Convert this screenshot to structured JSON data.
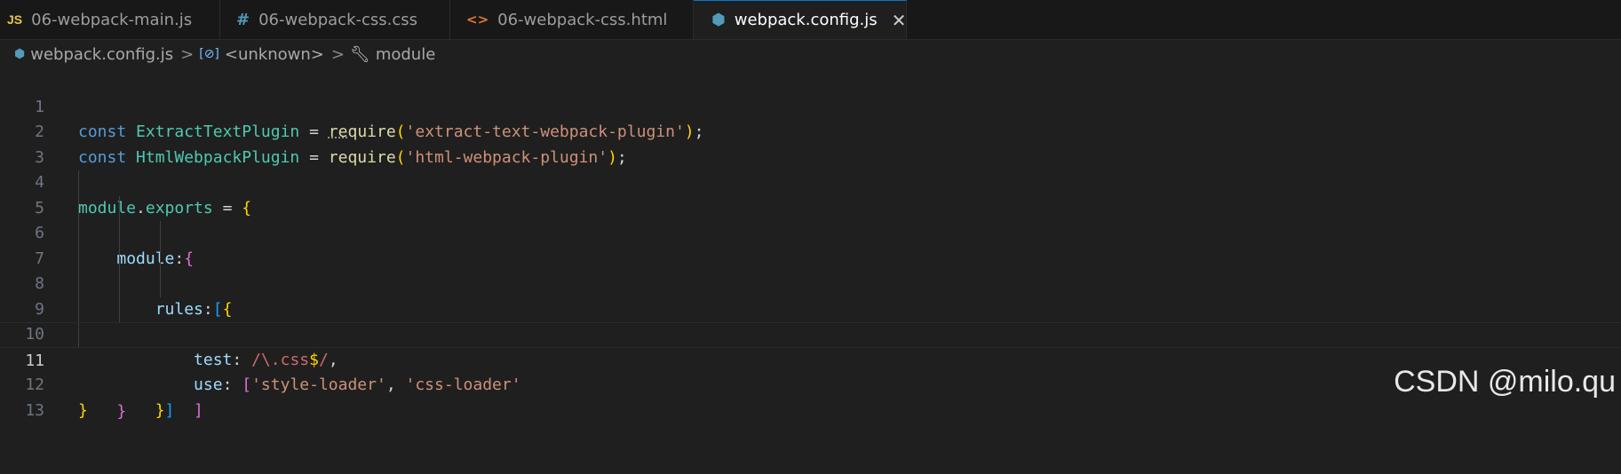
{
  "tabs": [
    {
      "icon_text": "JS",
      "icon": "js-file-icon",
      "label": "06-webpack-main.js"
    },
    {
      "icon_text": "#",
      "icon": "css-file-icon",
      "label": "06-webpack-css.css"
    },
    {
      "icon_text": "<>",
      "icon": "html-file-icon",
      "label": "06-webpack-css.html"
    },
    {
      "icon_text": "⬢",
      "icon": "config-file-icon",
      "label": "webpack.config.js",
      "close": "✕"
    }
  ],
  "breadcrumb": {
    "file": "webpack.config.js",
    "symbol": "<unknown>",
    "property": "module",
    "separator": ">"
  },
  "editor": {
    "line_numbers": [
      "1",
      "2",
      "3",
      "4",
      "5",
      "6",
      "7",
      "8",
      "9",
      "10",
      "11",
      "12",
      "13"
    ],
    "current_line": "11"
  },
  "watermark": "CSDN @milo.qu"
}
